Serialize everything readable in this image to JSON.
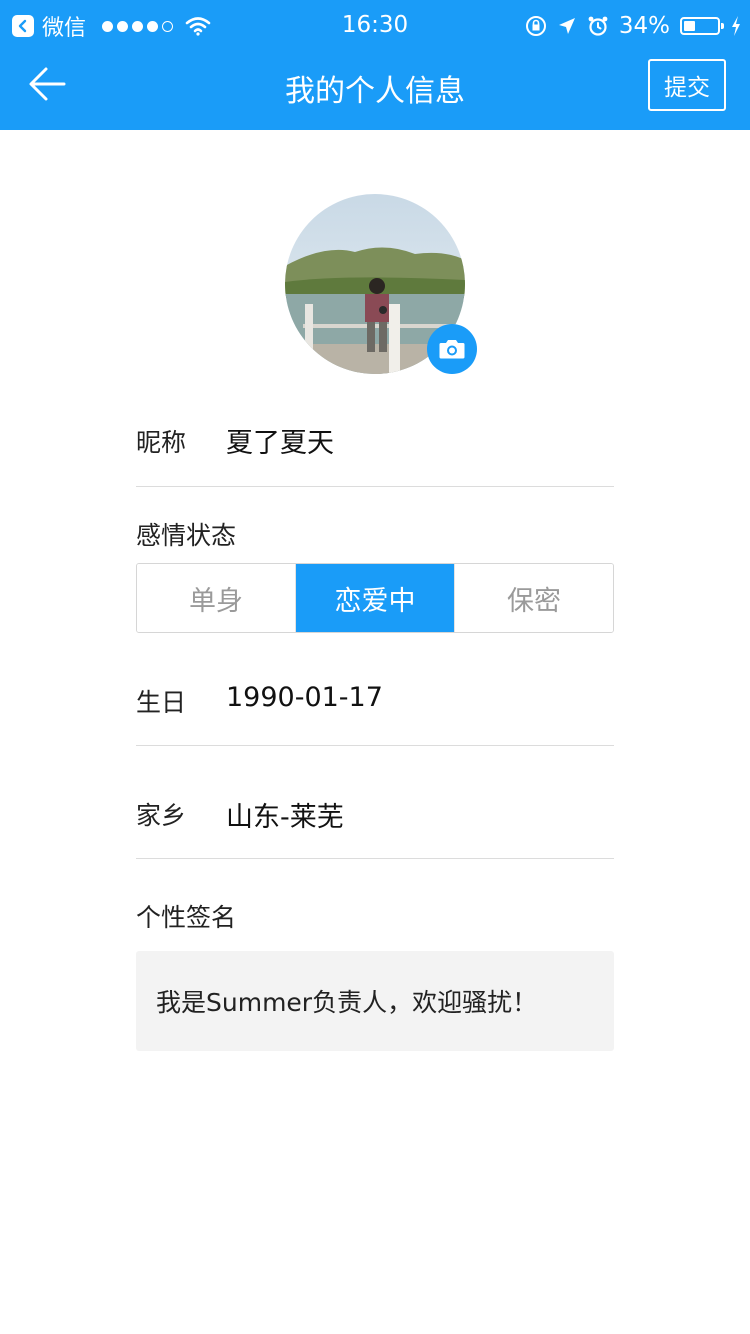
{
  "status_bar": {
    "carrier_app": "微信",
    "time": "16:30",
    "battery_percent": "34%",
    "battery_level": 0.34
  },
  "nav": {
    "title": "我的个人信息",
    "submit_label": "提交",
    "back_icon": "arrow-left-icon"
  },
  "profile": {
    "avatar_icon": "camera-icon"
  },
  "nickname": {
    "label": "昵称",
    "value": "夏了夏天"
  },
  "relationship": {
    "label": "感情状态",
    "options": [
      "单身",
      "恋爱中",
      "保密"
    ],
    "selected": "恋爱中"
  },
  "birthday": {
    "label": "生日",
    "value": "1990-01-17"
  },
  "hometown": {
    "label": "家乡",
    "value": "山东-莱芜"
  },
  "signature": {
    "label": "个性签名",
    "value": "我是Summer负责人，欢迎骚扰！"
  },
  "colors": {
    "primary": "#1a9cf8",
    "divider": "#dcdcdc",
    "signature_bg": "#f3f3f3"
  }
}
